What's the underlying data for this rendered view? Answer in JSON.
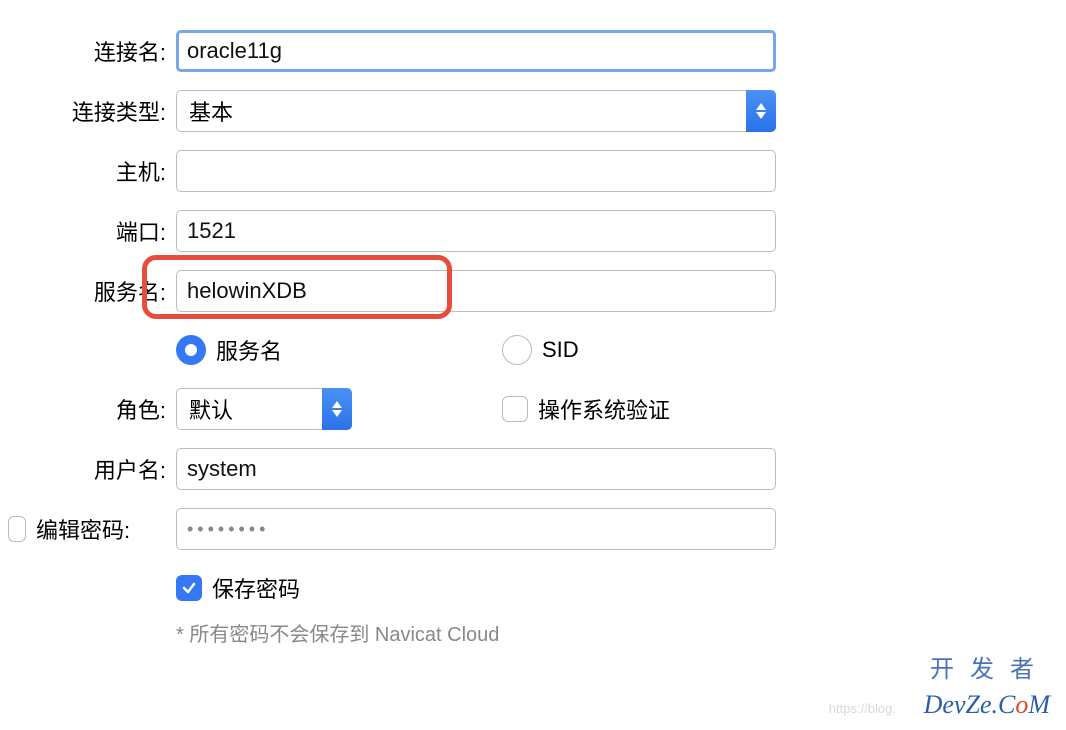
{
  "labels": {
    "connection_name": "连接名:",
    "connection_type": "连接类型:",
    "host": "主机:",
    "port": "端口:",
    "service_name": "服务名:",
    "role": "角色:",
    "username": "用户名:",
    "edit_password": "编辑密码:"
  },
  "fields": {
    "connection_name": "oracle11g",
    "connection_type": "基本",
    "host": "",
    "port": "1521",
    "service_name": "helowinXDB",
    "role": "默认",
    "username": "system",
    "password_masked": "••••••••"
  },
  "radios": {
    "service_name": "服务名",
    "sid": "SID"
  },
  "checks": {
    "os_auth": "操作系统验证",
    "save_password": "保存密码"
  },
  "hint": "* 所有密码不会保存到 Navicat Cloud",
  "watermark": {
    "cn": "开发者",
    "url": "https://blog.",
    "logo_a": "DevZe.C",
    "logo_o": "o",
    "logo_b": "M"
  }
}
